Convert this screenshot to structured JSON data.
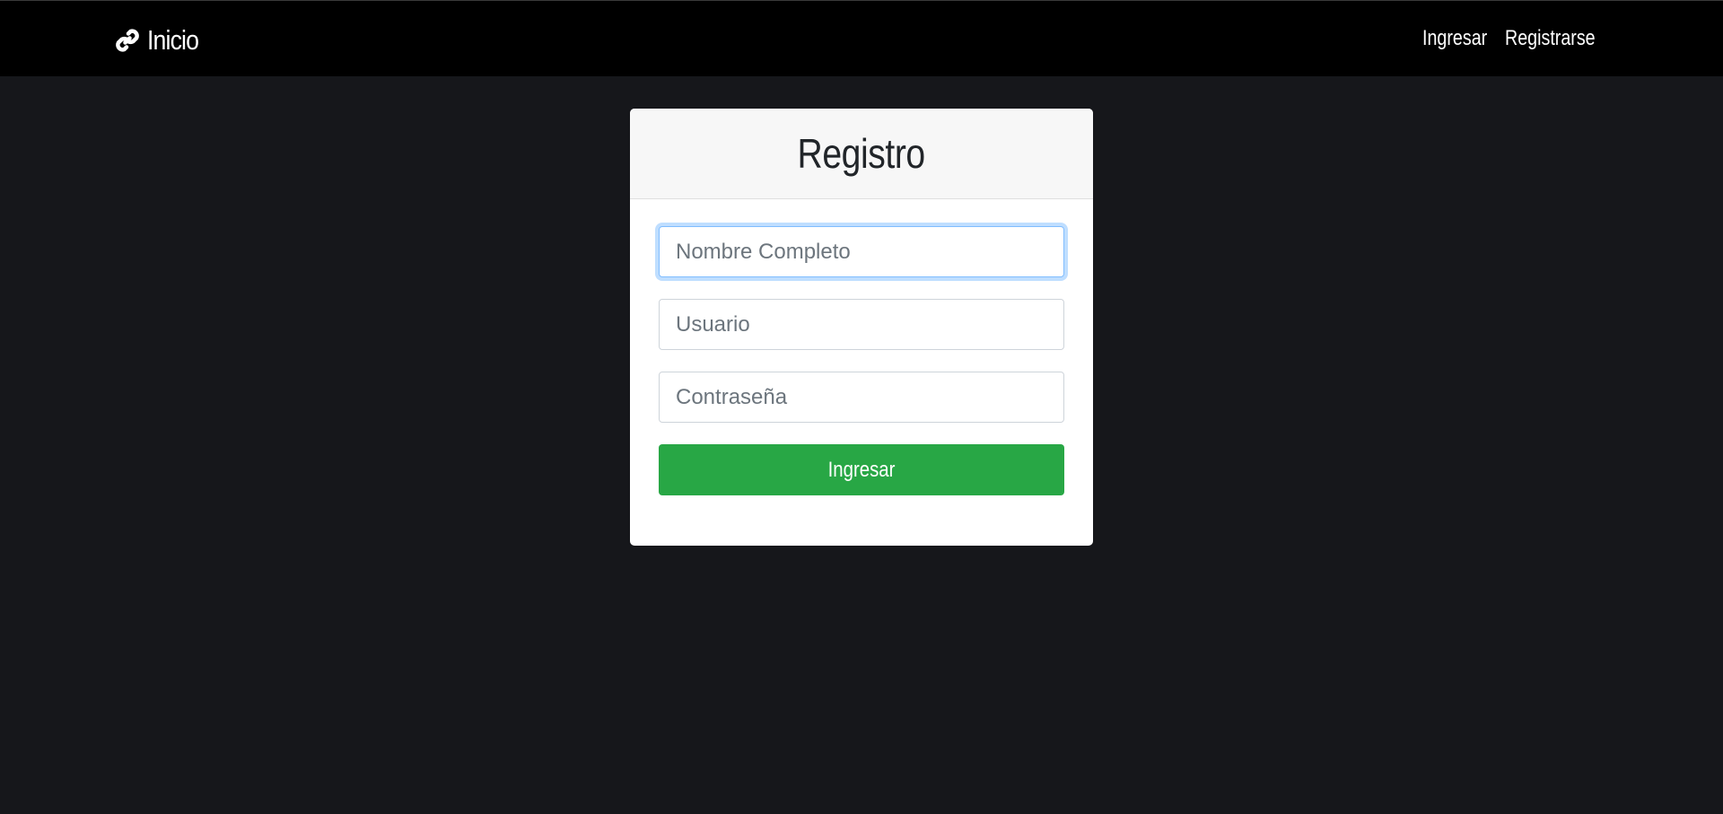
{
  "navbar": {
    "brand_icon": "link-icon",
    "brand_label": "Inicio",
    "links": [
      {
        "label": "Ingresar"
      },
      {
        "label": "Registrarse"
      }
    ]
  },
  "form": {
    "title": "Registro",
    "fields": [
      {
        "placeholder": "Nombre Completo",
        "value": "",
        "focused": true
      },
      {
        "placeholder": "Usuario",
        "value": ""
      },
      {
        "placeholder": "Contraseña",
        "value": ""
      }
    ],
    "submit_label": "Ingresar"
  },
  "colors": {
    "navbar_bg": "#000000",
    "page_bg": "#16171b",
    "card_bg": "#ffffff",
    "card_header_bg": "#f7f7f7",
    "submit_bg": "#28a745",
    "focus_ring": "#80bdff"
  }
}
